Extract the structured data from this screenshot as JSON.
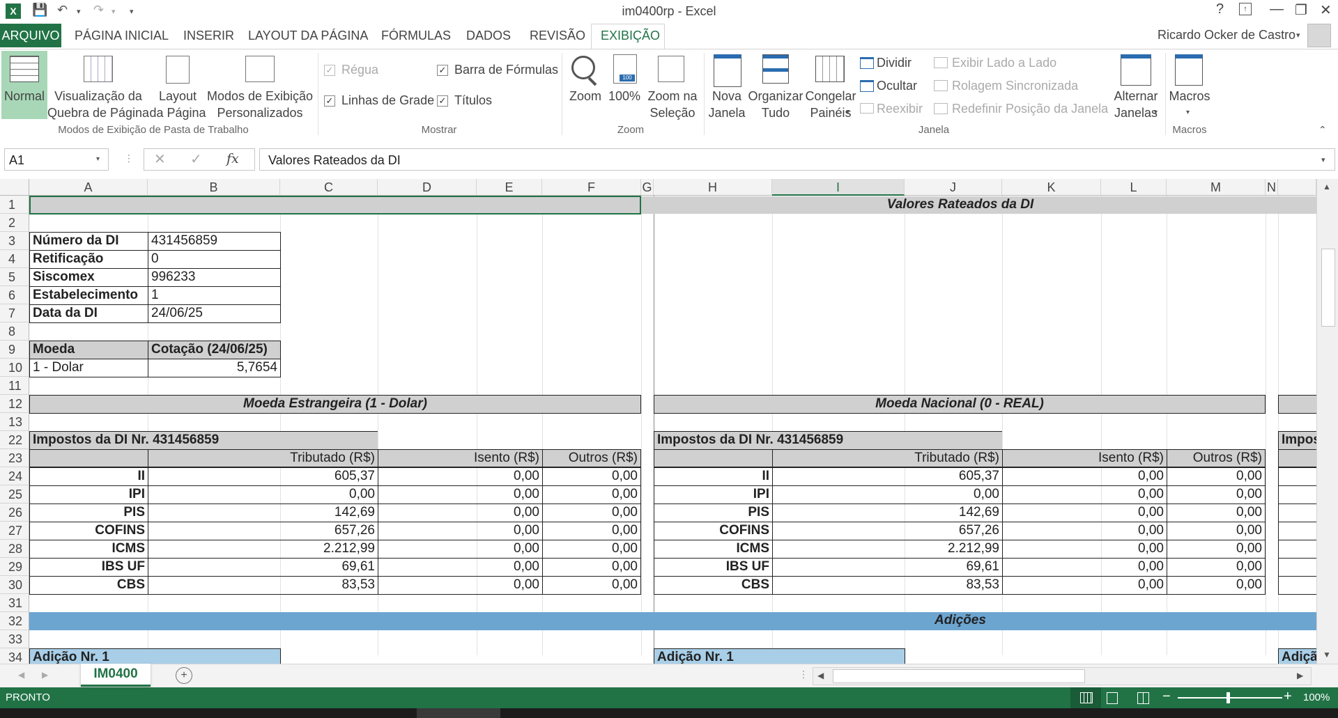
{
  "window": {
    "title": "im0400rp - Excel",
    "user": "Ricardo Ocker de Castro"
  },
  "tabs": {
    "file": "ARQUIVO",
    "items": [
      "PÁGINA INICIAL",
      "INSERIR",
      "LAYOUT DA PÁGINA",
      "FÓRMULAS",
      "DADOS",
      "REVISÃO",
      "EXIBIÇÃO"
    ]
  },
  "ribbon": {
    "views": {
      "normal": "Normal",
      "page_break_1": "Visualização da",
      "page_break_2": "Quebra de Página",
      "layout_1": "Layout",
      "layout_2": "da Página",
      "custom_1": "Modos de Exibição",
      "custom_2": "Personalizados",
      "group": "Modos de Exibição de Pasta de Trabalho"
    },
    "show": {
      "ruler": "Régua",
      "gridlines": "Linhas de Grade",
      "formula_bar": "Barra de Fórmulas",
      "headings": "Títulos",
      "group": "Mostrar"
    },
    "zoom": {
      "zoom": "Zoom",
      "hundred": "100%",
      "selection_1": "Zoom na",
      "selection_2": "Seleção",
      "group": "Zoom"
    },
    "window": {
      "new_1": "Nova",
      "new_2": "Janela",
      "arrange_1": "Organizar",
      "arrange_2": "Tudo",
      "freeze_1": "Congelar",
      "freeze_2": "Painéis",
      "split": "Dividir",
      "hide": "Ocultar",
      "unhide": "Reexibir",
      "side": "Exibir Lado a Lado",
      "sync": "Rolagem Sincronizada",
      "reset": "Redefinir Posição da Janela",
      "switch_1": "Alternar",
      "switch_2": "Janelas",
      "group": "Janela"
    },
    "macros": {
      "label": "Macros",
      "group": "Macros"
    }
  },
  "formula_bar": {
    "name_box": "A1",
    "fx": "fx",
    "value": "Valores Rateados da DI"
  },
  "columns": [
    "A",
    "B",
    "C",
    "D",
    "E",
    "F",
    "G",
    "H",
    "I",
    "J",
    "K",
    "L",
    "M",
    "N"
  ],
  "rows": [
    "1",
    "2",
    "3",
    "4",
    "5",
    "6",
    "7",
    "8",
    "9",
    "10",
    "11",
    "12",
    "13",
    "22",
    "23",
    "24",
    "25",
    "26",
    "27",
    "28",
    "29",
    "30",
    "31",
    "32",
    "33",
    "34"
  ],
  "sheet": {
    "title": "Valores Rateados da DI",
    "info": [
      {
        "label": "Número da DI",
        "value": "431456859"
      },
      {
        "label": "Retificação",
        "value": "0"
      },
      {
        "label": "Siscomex",
        "value": "996233"
      },
      {
        "label": "Estabelecimento",
        "value": "1"
      },
      {
        "label": "Data da DI",
        "value": "24/06/25"
      }
    ],
    "currency_hdr": {
      "moeda": "Moeda",
      "cotacao": "Cotação (24/06/25)"
    },
    "currency": {
      "name": "1 - Dolar",
      "rate": "5,7654"
    },
    "foreign_title": "Moeda Estrangeira (1 - Dolar)",
    "national_title": "Moeda Nacional (0 - REAL)",
    "taxes_title": "Impostos da DI Nr. 431456859",
    "taxes_title_cut": "Impos",
    "tax_cols": {
      "tributado": "Tributado (R$)",
      "isento": "Isento (R$)",
      "outros": "Outros (R$)"
    },
    "taxes": [
      {
        "name": "II",
        "tributado": "605,37",
        "isento": "0,00",
        "outros": "0,00"
      },
      {
        "name": "IPI",
        "tributado": "0,00",
        "isento": "0,00",
        "outros": "0,00"
      },
      {
        "name": "PIS",
        "tributado": "142,69",
        "isento": "0,00",
        "outros": "0,00"
      },
      {
        "name": "COFINS",
        "tributado": "657,26",
        "isento": "0,00",
        "outros": "0,00"
      },
      {
        "name": "ICMS",
        "tributado": "2.212,99",
        "isento": "0,00",
        "outros": "0,00"
      },
      {
        "name": "IBS UF",
        "tributado": "69,61",
        "isento": "0,00",
        "outros": "0,00"
      },
      {
        "name": "CBS",
        "tributado": "83,53",
        "isento": "0,00",
        "outros": "0,00"
      }
    ],
    "additions_title": "Adições",
    "addition_label": "Adição Nr. 1",
    "addition_cut": "Adiçã"
  },
  "sheet_tab": "IM0400",
  "status": {
    "ready": "PRONTO",
    "zoom": "100%"
  },
  "colors": {
    "excel_green": "#217346",
    "header_gray": "#d0d0d0",
    "light_blue": "#a9cfe8",
    "dark_blue": "#6da5d1"
  }
}
